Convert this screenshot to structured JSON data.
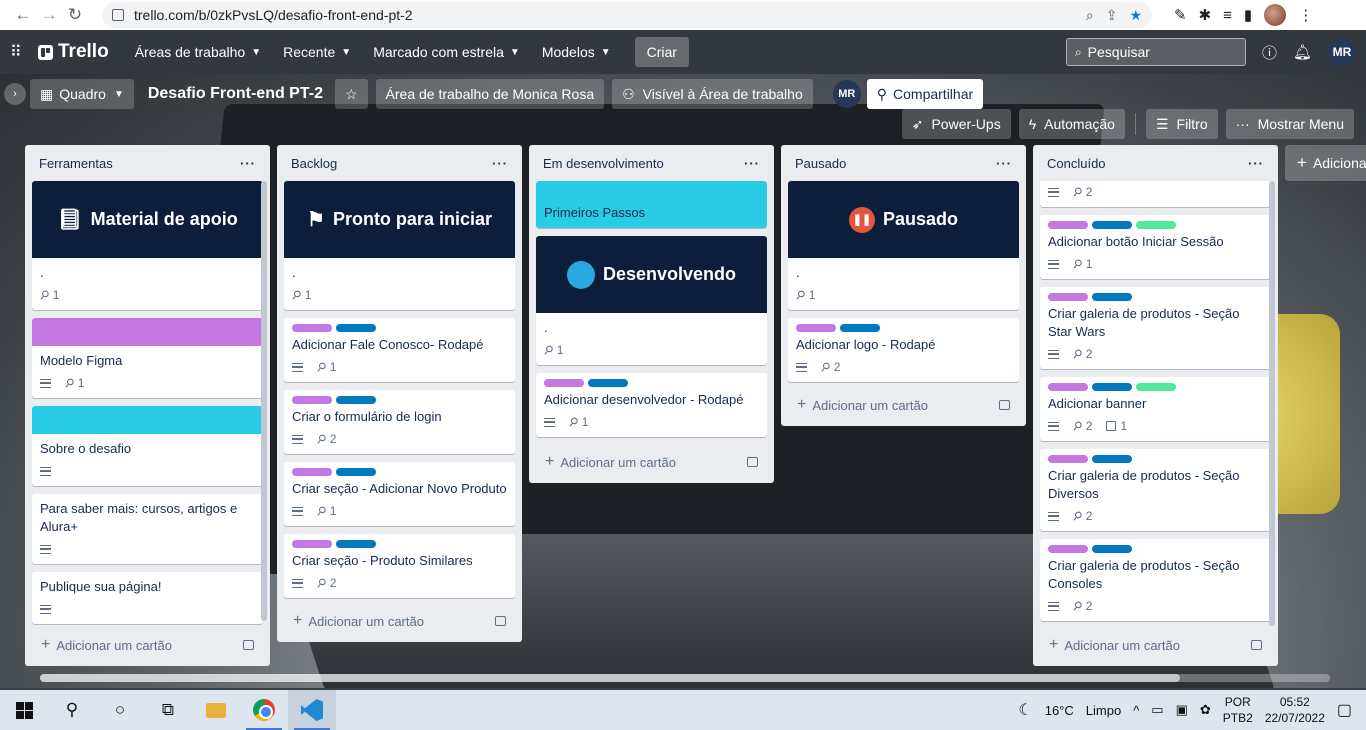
{
  "browser": {
    "url": "trello.com/b/0zkPvsLQ/desafio-front-end-pt-2",
    "profile_initials": ""
  },
  "header": {
    "brand": "Trello",
    "menu": [
      {
        "label": "Áreas de trabalho"
      },
      {
        "label": "Recente"
      },
      {
        "label": "Marcado com estrela"
      },
      {
        "label": "Modelos"
      }
    ],
    "create_label": "Criar",
    "search_placeholder": "Pesquisar",
    "avatar": "MR"
  },
  "board": {
    "view_label": "Quadro",
    "title": "Desafio Front-end PT-2",
    "workspace_label": "Área de trabalho de Monica Rosa",
    "visibility_label": "Visível à Área de trabalho",
    "member_avatar": "MR",
    "share_label": "Compartilhar",
    "powerups_label": "Power-Ups",
    "automation_label": "Automação",
    "filter_label": "Filtro",
    "menu_label": "Mostrar Menu",
    "add_list_label": "Adicionar"
  },
  "colors": {
    "purple": "#c377e0",
    "blue": "#0079bf",
    "green": "#51e898",
    "cyan": "#29cce5",
    "navy": "#0c1e3a"
  },
  "add_card_label": "Adicionar um cartão",
  "lists": [
    {
      "name": "Ferramentas",
      "cards": [
        {
          "cover_text": "Material de apoio",
          "cover_icon": "notebook-icon",
          "title": ".",
          "attachments": "1"
        },
        {
          "color_cover": "#c377e0",
          "title": "Modelo Figma",
          "desc": true,
          "attachments": "1"
        },
        {
          "color_cover": "#29cce5",
          "title": "Sobre o desafio",
          "desc": true
        },
        {
          "title": "Para saber mais: cursos, artigos e Alura+",
          "desc": true
        },
        {
          "title": "Publique sua página!",
          "desc": true
        }
      ]
    },
    {
      "name": "Backlog",
      "cards": [
        {
          "cover_text": "Pronto para iniciar",
          "cover_icon": "checkered-flag-icon",
          "title": ".",
          "attachments": "1"
        },
        {
          "labels": [
            "#c377e0",
            "#0079bf"
          ],
          "title": "Adicionar Fale Conosco- Rodapé",
          "desc": true,
          "attachments": "1"
        },
        {
          "labels": [
            "#c377e0",
            "#0079bf"
          ],
          "title": "Criar o formulário de login",
          "desc": true,
          "attachments": "2"
        },
        {
          "labels": [
            "#c377e0",
            "#0079bf"
          ],
          "title": "Criar seção - Adicionar Novo Produto",
          "desc": true,
          "attachments": "1"
        },
        {
          "labels": [
            "#c377e0",
            "#0079bf"
          ],
          "title": "Criar seção - Produto Similares",
          "desc": true,
          "attachments": "2"
        }
      ]
    },
    {
      "name": "Em desenvolvimento",
      "cards": [
        {
          "cyan_title": "Primeiros Passos"
        },
        {
          "cover_text": "Desenvolvendo",
          "cover_icon": "code-window-icon",
          "title": ".",
          "attachments": "1"
        },
        {
          "labels": [
            "#c377e0",
            "#0079bf"
          ],
          "title": "Adicionar desenvolvedor - Rodapé",
          "desc": true,
          "attachments": "1"
        }
      ]
    },
    {
      "name": "Pausado",
      "cards": [
        {
          "cover_text": "Pausado",
          "cover_icon": "pause-icon",
          "title": ".",
          "attachments": "1"
        },
        {
          "labels": [
            "#c377e0",
            "#0079bf"
          ],
          "title": "Adicionar logo - Rodapé",
          "desc": true,
          "attachments": "2"
        }
      ]
    },
    {
      "name": "Concluído",
      "cards": [
        {
          "title": "",
          "desc": true,
          "attachments": "2",
          "clipped": true
        },
        {
          "labels": [
            "#c377e0",
            "#0079bf",
            "#51e898"
          ],
          "title": "Adicionar botão Iniciar Sessão",
          "desc": true,
          "attachments": "1"
        },
        {
          "labels": [
            "#c377e0",
            "#0079bf"
          ],
          "title": "Criar galeria de produtos - Seção Star Wars",
          "desc": true,
          "attachments": "2"
        },
        {
          "labels": [
            "#c377e0",
            "#0079bf",
            "#51e898"
          ],
          "title": "Adicionar banner",
          "desc": true,
          "attachments": "2",
          "checklist": "1"
        },
        {
          "labels": [
            "#c377e0",
            "#0079bf"
          ],
          "title": "Criar galeria de produtos - Seção Diversos",
          "desc": true,
          "attachments": "2"
        },
        {
          "labels": [
            "#c377e0",
            "#0079bf"
          ],
          "title": "Criar galeria de produtos - Seção Consoles",
          "desc": true,
          "attachments": "2"
        }
      ]
    }
  ],
  "taskbar": {
    "weather_temp": "16°C",
    "weather_text": "Limpo",
    "lang_top": "POR",
    "lang_bottom": "PTB2",
    "time": "05:52",
    "date": "22/07/2022"
  }
}
